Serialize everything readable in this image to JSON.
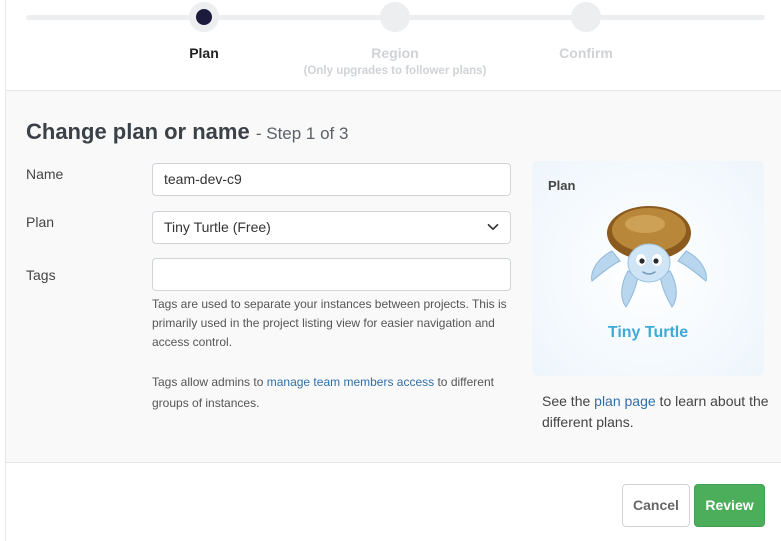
{
  "stepper": {
    "steps": [
      {
        "label": "Plan",
        "sub": ""
      },
      {
        "label": "Region",
        "sub": "(Only upgrades to follower plans)"
      },
      {
        "label": "Confirm",
        "sub": ""
      }
    ],
    "active_index": 0
  },
  "form": {
    "title": "Change plan or name",
    "step_text": "- Step 1 of 3",
    "name_label": "Name",
    "name_value": "team-dev-c9",
    "plan_label": "Plan",
    "plan_value": "Tiny Turtle (Free)",
    "tags_label": "Tags",
    "tags_value": "",
    "tags_help": "Tags are used to separate your instances between projects. This is primarily used in the project listing view for easier navigation and access control.",
    "tags_admin_prefix": "Tags allow admins to ",
    "tags_admin_link": "manage team members access",
    "tags_admin_suffix": " to different groups of instances."
  },
  "plan_card": {
    "label": "Plan",
    "name": "Tiny Turtle",
    "note_prefix": "See the ",
    "note_link": "plan page",
    "note_suffix": " to learn about the different plans."
  },
  "footer": {
    "cancel_label": "Cancel",
    "review_label": "Review"
  },
  "colors": {
    "active_step": "#1c1b3c",
    "link": "#2f6fa8",
    "plan_name": "#3fa9d8",
    "review_button": "#4cae5b"
  },
  "icons": {
    "plan_select": "chevron-down-icon",
    "plan_image": "turtle-icon"
  }
}
